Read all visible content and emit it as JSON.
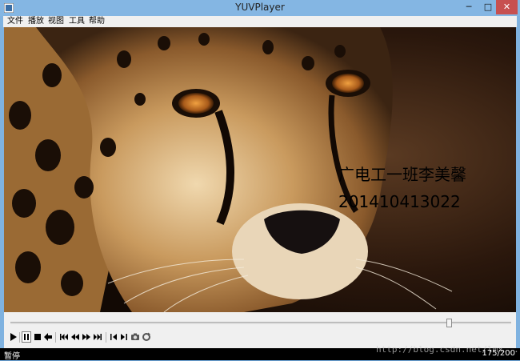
{
  "window": {
    "title": "YUVPlayer"
  },
  "titlebar_buttons": {
    "minimize": "─",
    "maximize": "□",
    "close": "✕"
  },
  "menu": [
    "文件",
    "播放",
    "视图",
    "工具",
    "帮助"
  ],
  "overlay": {
    "line1": "广电工一班李美馨",
    "line2": "201410413022"
  },
  "seek": {
    "position_fraction": 0.875
  },
  "toolbar_icons": [
    "play-icon",
    "pause-icon",
    "stop-icon",
    "back-icon",
    "first-frame-icon",
    "rewind-icon",
    "forward-icon",
    "last-frame-icon",
    "prev-step-icon",
    "next-step-icon",
    "snapshot-icon",
    "refresh-icon"
  ],
  "status": {
    "left": "暂停",
    "right": "175/200"
  },
  "watermark": "http://blog.csdn.net/lmx..."
}
